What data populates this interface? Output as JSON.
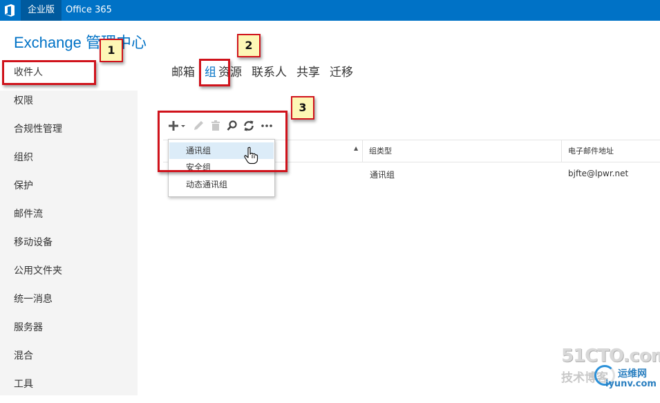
{
  "topbar": {
    "enterprise_label": "企业版",
    "o365_label": "Office 365",
    "logo_icon": "office-logo-icon",
    "color": "#0072c6"
  },
  "app": {
    "title": "Exchange 管理中心"
  },
  "sidebar": {
    "items": [
      {
        "label": "收件人",
        "active": true
      },
      {
        "label": "权限"
      },
      {
        "label": "合规性管理"
      },
      {
        "label": "组织"
      },
      {
        "label": "保护"
      },
      {
        "label": "邮件流"
      },
      {
        "label": "移动设备"
      },
      {
        "label": "公用文件夹"
      },
      {
        "label": "统一消息"
      },
      {
        "label": "服务器"
      },
      {
        "label": "混合"
      },
      {
        "label": "工具"
      }
    ]
  },
  "tabs": [
    {
      "label": "邮箱"
    },
    {
      "label": "组",
      "active": true
    },
    {
      "label": "资源"
    },
    {
      "label": "联系人"
    },
    {
      "label": "共享"
    },
    {
      "label": "迁移"
    }
  ],
  "toolbar": {
    "new_icon": "plus-icon",
    "edit_icon": "pencil-icon",
    "delete_icon": "trash-icon",
    "search_icon": "search-icon",
    "refresh_icon": "refresh-icon",
    "more_icon": "more-icon"
  },
  "new_menu": {
    "items": [
      "通讯组",
      "安全组",
      "动态通讯组"
    ],
    "hovered": "通讯组"
  },
  "table": {
    "columns": [
      "组类型",
      "电子邮件地址"
    ],
    "rows": [
      {
        "type": "通讯组",
        "email": "bjfte@lpwr.net"
      }
    ]
  },
  "annotations": {
    "callouts": [
      "1",
      "2",
      "3"
    ],
    "color": "#d0121b"
  },
  "watermark": {
    "brand": "51CTO.com",
    "blog": "技术博客",
    "yunwei": "运维网",
    "domain": "iyunv.com"
  }
}
